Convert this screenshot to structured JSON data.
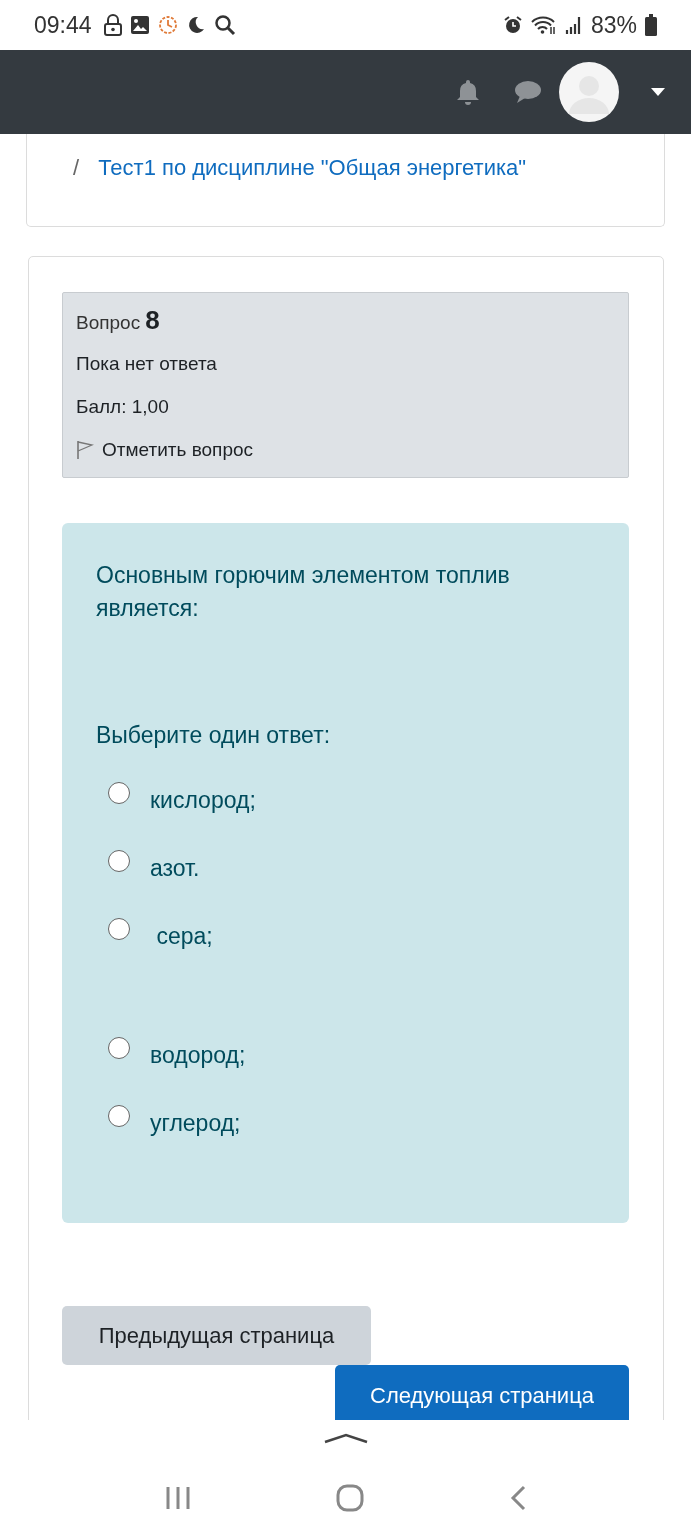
{
  "status_bar": {
    "time": "09:44",
    "battery": "83%"
  },
  "breadcrumb": [
    {
      "separator": "/",
      "label": "Тест1 по дисциплине \"Общая энергетика\""
    }
  ],
  "question_info": {
    "label": "Вопрос",
    "number": "8",
    "state": "Пока нет ответа",
    "mark": "Балл: 1,00",
    "flag": "Отметить вопрос"
  },
  "question": {
    "text": "Основным горючим элементом топлив является:",
    "prompt": "Выберите один ответ:",
    "options": [
      {
        "label": "кислород;",
        "selected": false
      },
      {
        "label": "азот.",
        "selected": false
      },
      {
        "label": " сера;",
        "selected": false
      },
      {
        "label": "водород;",
        "selected": false
      },
      {
        "label": "углерод;",
        "selected": false
      }
    ]
  },
  "buttons": [
    {
      "label": "Предыдущая страница",
      "kind": "secondary"
    },
    {
      "label": "Следующая страница",
      "kind": "primary"
    }
  ]
}
